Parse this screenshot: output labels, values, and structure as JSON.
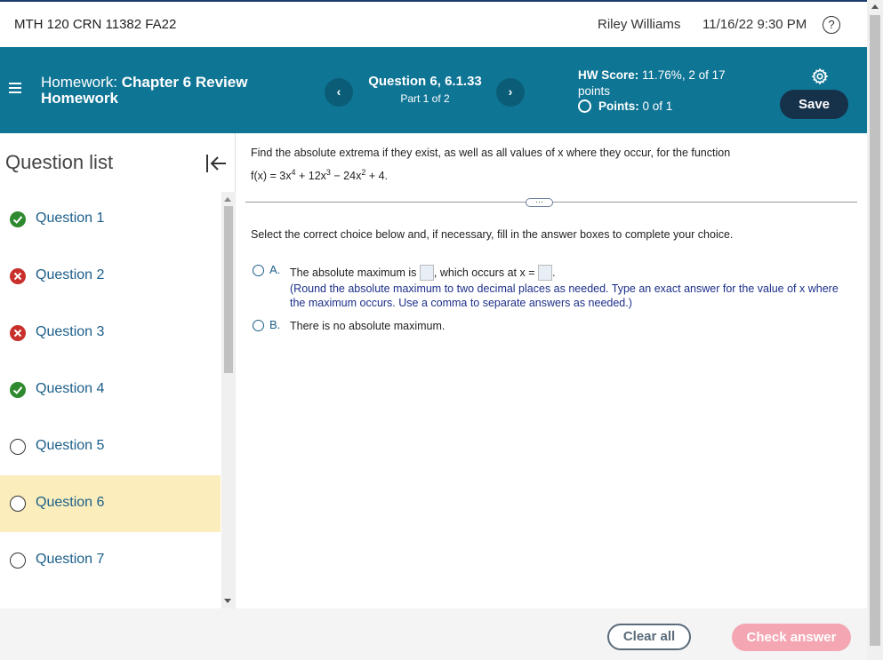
{
  "topbar": {
    "course": "MTH 120 CRN 11382 FA22",
    "user": "Riley Williams",
    "datetime": "11/16/22 9:30 PM",
    "help_glyph": "?"
  },
  "header": {
    "hw_prefix": "Homework:",
    "hw_name_line1": "Chapter 6 Review",
    "hw_name_line2": "Homework",
    "prev_glyph": "‹",
    "next_glyph": "›",
    "question_title": "Question 6, 6.1.33",
    "question_part": "Part 1 of 2",
    "hw_score_label": "HW Score:",
    "hw_score_value": "11.76%, 2 of 17",
    "hw_score_unit": "points",
    "points_label": "Points:",
    "points_value": "0 of 1",
    "save_label": "Save"
  },
  "sidebar": {
    "title": "Question list",
    "items": [
      {
        "label": "Question 1",
        "status": "correct"
      },
      {
        "label": "Question 2",
        "status": "incorrect"
      },
      {
        "label": "Question 3",
        "status": "incorrect"
      },
      {
        "label": "Question 4",
        "status": "correct"
      },
      {
        "label": "Question 5",
        "status": "unanswered"
      },
      {
        "label": "Question 6",
        "status": "unanswered",
        "active": true
      },
      {
        "label": "Question 7",
        "status": "unanswered"
      }
    ]
  },
  "problem": {
    "prompt": "Find the absolute extrema if they exist, as well as all values of x where they occur, for the function",
    "formula": {
      "t1": "f(x) = 3x",
      "e1": "4",
      "t2": " + 12x",
      "e2": "3",
      "t3": " − 24x",
      "e3": "2",
      "t4": " + 4."
    },
    "more_glyph": "···",
    "instruction": "Select the correct choice below and, if necessary, fill in the answer boxes to complete your choice.",
    "choice_a": {
      "letter": "A.",
      "text1": "The absolute maximum is",
      "text2": ", which occurs at x =",
      "text3": ".",
      "hint": "(Round the absolute maximum to two decimal places as needed. Type an exact answer for the value of x where the maximum occurs. Use a comma to separate answers as needed.)"
    },
    "choice_b": {
      "letter": "B.",
      "text": "There is no absolute maximum."
    }
  },
  "footer": {
    "clear_all": "Clear all",
    "check_answer": "Check answer"
  },
  "colors": {
    "header_bg": "#0f7595",
    "save_bg": "#16314a",
    "active_question_bg": "#fbeebc",
    "correct": "#2f8a2f",
    "incorrect": "#c9302c",
    "check_answer_bg": "#f4a6b3"
  }
}
